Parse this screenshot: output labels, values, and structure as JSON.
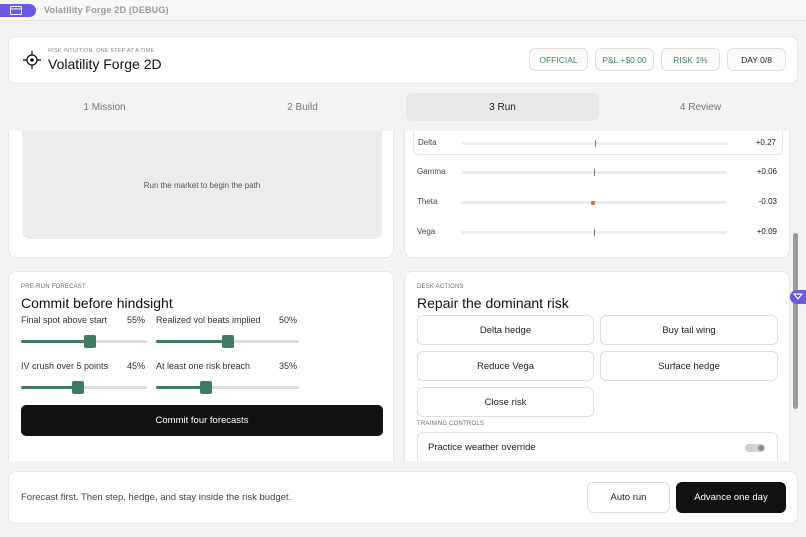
{
  "window": {
    "title": "Volatility Forge 2D (DEBUG)",
    "accent": "#6b57e8"
  },
  "header": {
    "eyebrow": "RISK INTUITION, ONE STEP AT A TIME",
    "title": "Volatility Forge 2D",
    "pills": {
      "official": "OFFICIAL",
      "pnl": "P&L  +$0.00",
      "risk": "RISK  1%",
      "day": "DAY  0/8"
    }
  },
  "steps": [
    {
      "label": "1  Mission",
      "active": false
    },
    {
      "label": "2  Build",
      "active": false
    },
    {
      "label": "3  Run",
      "active": true
    },
    {
      "label": "4  Review",
      "active": false
    }
  ],
  "path_canvas": {
    "placeholder": "Run the market to begin the path"
  },
  "greeks": [
    {
      "name": "Delta",
      "value": "+0.27",
      "level": 0.5
    },
    {
      "name": "Gamma",
      "value": "+0.06",
      "level": 0.5
    },
    {
      "name": "Theta",
      "value": "-0.03",
      "level": 0.49
    },
    {
      "name": "Vega",
      "value": "+0.09",
      "level": 0.5
    }
  ],
  "forecast": {
    "eyebrow": "PRE-RUN FORECAST",
    "title": "Commit before hindsight",
    "items": [
      {
        "label": "Final spot above start",
        "pct": "55%",
        "value": 0.55
      },
      {
        "label": "Realized vol beats implied",
        "pct": "50%",
        "value": 0.5
      },
      {
        "label": "IV crush over 5 points",
        "pct": "45%",
        "value": 0.45
      },
      {
        "label": "At least one risk breach",
        "pct": "35%",
        "value": 0.35
      }
    ],
    "commit_label": "Commit four forecasts"
  },
  "desk": {
    "eyebrow": "DESK ACTIONS",
    "title": "Repair the dominant risk",
    "actions": {
      "delta_hedge": "Delta hedge",
      "buy_tail_wing": "Buy tail wing",
      "reduce_vega": "Reduce Vega",
      "surface_hedge": "Surface hedge",
      "close_risk": "Close risk"
    },
    "training_eyebrow": "TRAINING CONTROLS",
    "weather_override": "Practice weather override",
    "weather_override_on": false
  },
  "footer": {
    "hint": "Forecast first. Then step, hedge, and stay inside the risk budget.",
    "auto_run": "Auto run",
    "advance": "Advance one day"
  },
  "colors": {
    "slider": "#3c7d64",
    "pill_green": "#3f8a63",
    "theta_marker": "#d67b3a"
  }
}
